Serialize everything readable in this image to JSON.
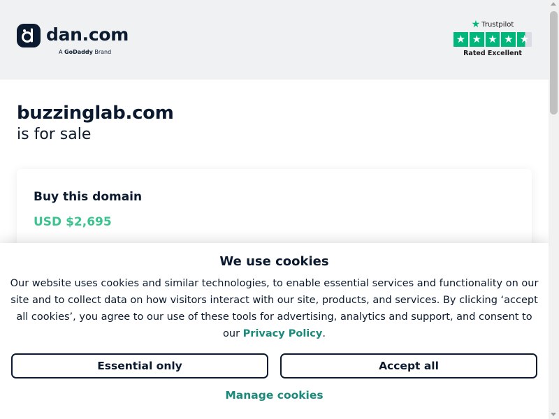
{
  "header": {
    "brand_name": "dan.com",
    "tagline_prefix": "A",
    "tagline_brand": "GoDaddy",
    "tagline_suffix": "Brand",
    "trustpilot": {
      "name": "Trustpilot",
      "stars": 4.5,
      "rating_label": "Rated Excellent",
      "star_color": "#00b67a"
    }
  },
  "main": {
    "domain": "buzzinglab.com",
    "subtitle": "is for sale",
    "card": {
      "title": "Buy this domain",
      "price": "USD $2,695",
      "price_color": "#3bc48f"
    }
  },
  "cookie_banner": {
    "title": "We use cookies",
    "body": "Our website uses cookies and similar technologies, to enable essential services and functionality on our site and to collect data on how visitors interact with our site, products, and services. By clicking ‘accept all cookies’, you agree to our use of these tools for advertising, analytics and support, and consent to our",
    "privacy_link": "Privacy Policy",
    "body_end": ".",
    "essential_button": "Essential only",
    "accept_button": "Accept all",
    "manage_link": "Manage cookies",
    "link_color": "#1b8a7a"
  },
  "icons": {
    "logo": "dan-logo-icon",
    "trustpilot_star": "star-icon"
  }
}
